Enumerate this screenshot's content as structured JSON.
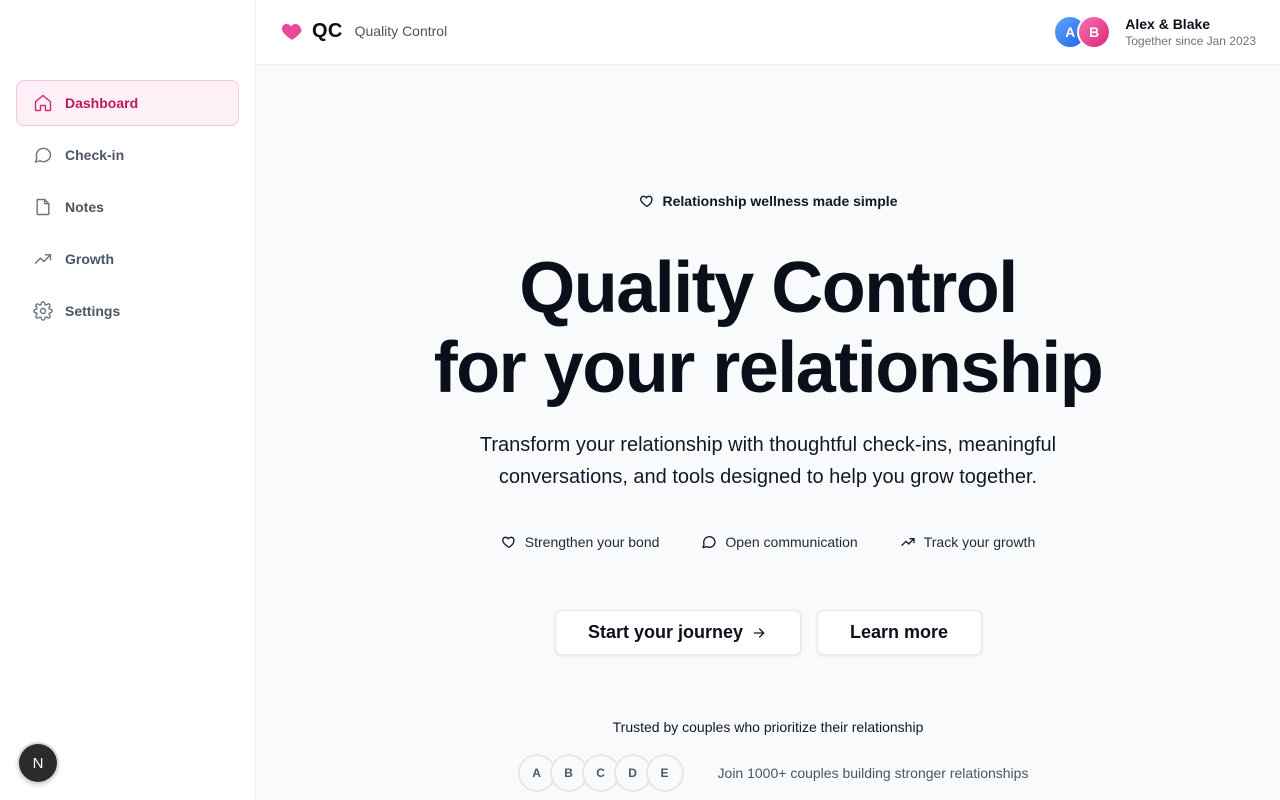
{
  "sidebar": {
    "items": [
      {
        "label": "Dashboard",
        "icon": "home-icon",
        "active": true
      },
      {
        "label": "Check-in",
        "icon": "chat-bubble-icon",
        "active": false
      },
      {
        "label": "Notes",
        "icon": "file-icon",
        "active": false
      },
      {
        "label": "Growth",
        "icon": "trending-up-icon",
        "active": false
      },
      {
        "label": "Settings",
        "icon": "gear-icon",
        "active": false
      }
    ],
    "dev_badge": "N"
  },
  "header": {
    "logo": "QC",
    "subtitle": "Quality Control",
    "couple": {
      "avatar_a": "A",
      "avatar_b": "B",
      "names": "Alex & Blake",
      "since": "Together since Jan 2023"
    }
  },
  "hero": {
    "tagline": "Relationship wellness made simple",
    "title_line1": "Quality Control",
    "title_line2": "for your relationship",
    "description": "Transform your relationship with thoughtful check-ins, meaningful conversations, and tools designed to help you grow together.",
    "features": [
      {
        "label": "Strengthen your bond",
        "icon": "heart-icon"
      },
      {
        "label": "Open communication",
        "icon": "chat-bubble-icon"
      },
      {
        "label": "Track your growth",
        "icon": "trending-up-icon"
      }
    ],
    "primary_button": "Start your journey",
    "secondary_button": "Learn more",
    "trusted": "Trusted by couples who prioritize their relationship",
    "circles": [
      "A",
      "B",
      "C",
      "D",
      "E"
    ],
    "join_text": "Join 1000+ couples building stronger relationships"
  },
  "colors": {
    "brand_pink": "#ec4899",
    "active_text": "#be185d",
    "active_bg": "#fdf0f6"
  }
}
